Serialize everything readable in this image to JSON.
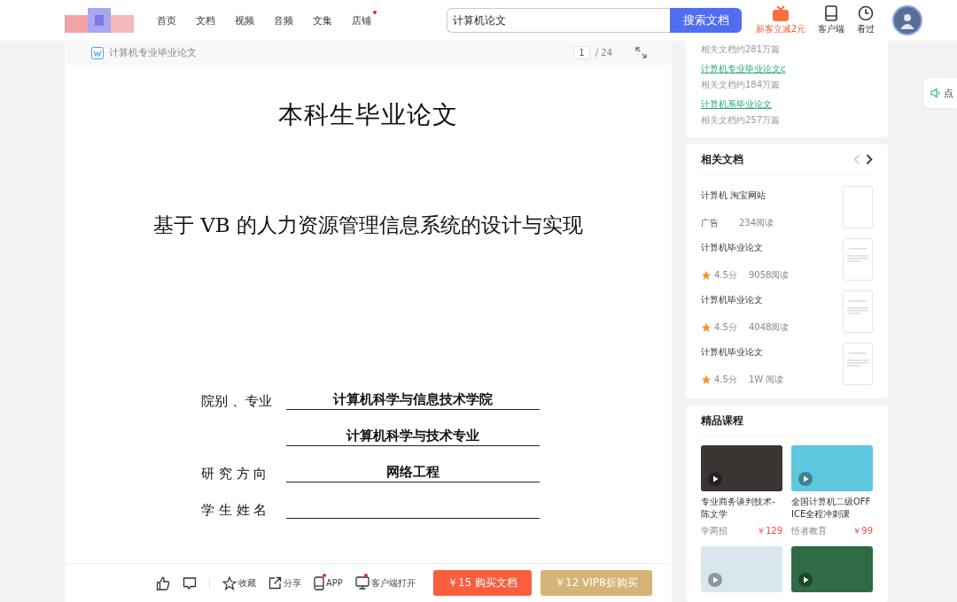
{
  "nav": [
    {
      "label": "首页",
      "dot": false
    },
    {
      "label": "文档",
      "dot": false
    },
    {
      "label": "视频",
      "dot": false
    },
    {
      "label": "音频",
      "dot": false
    },
    {
      "label": "文集",
      "dot": false
    },
    {
      "label": "店铺",
      "dot": true
    }
  ],
  "search": {
    "value": "计算机论文",
    "button": "搜索文档"
  },
  "header_actions": [
    {
      "kind": "vip",
      "label": "新客立减2元"
    },
    {
      "kind": "device",
      "label": "客户端"
    },
    {
      "kind": "clock",
      "label": "看过"
    }
  ],
  "doc_toolbar": {
    "title": "计算机专业毕业论文",
    "page": "1",
    "total": "/ 24"
  },
  "document": {
    "subtitle": "本科生毕业论文",
    "title": "基于 VB 的人力资源管理信息系统的设计与实现",
    "fields": [
      {
        "label": "院别 、专业",
        "value": "计算机科学与信息技术学院"
      },
      {
        "value": "计算机科学与技术专业"
      },
      {
        "label": "研 究 方 向",
        "value": "网络工程"
      },
      {
        "label": "学 生 姓 名"
      }
    ]
  },
  "actions": [
    {
      "kind": "like",
      "dot": false
    },
    {
      "kind": "comment",
      "dot": false
    },
    {
      "kind": "star",
      "label": "收藏",
      "dot": false
    },
    {
      "kind": "share",
      "label": "分享",
      "dot": false
    },
    {
      "kind": "phone",
      "label": "APP",
      "dot": true
    },
    {
      "kind": "monitor",
      "label": "客户端打开",
      "dot": true
    }
  ],
  "buy_buttons": [
    {
      "kind": "buy",
      "label": "￥15 购买文档"
    },
    {
      "kind": "vip",
      "label": "￥12 VIP8折购买"
    }
  ],
  "related_searches": [
    {
      "count": "相关文档约281万篇"
    },
    {
      "link": "计算机专业毕业论文c",
      "count": "相关文档约184万篇"
    },
    {
      "link": "计算机系毕业论文",
      "count": "相关文档约257万篇"
    }
  ],
  "related_docs": {
    "title": "相关文档",
    "items": [
      {
        "kind": "ad",
        "title": "计算机 淘宝网站",
        "tag": "广告",
        "reads": "234阅读"
      },
      {
        "kind": "doc",
        "title": "计算机毕业论文",
        "score": "4.5分",
        "reads": "9058阅读"
      },
      {
        "kind": "doc",
        "title": "计算机毕业论文",
        "score": "4.5分",
        "reads": "4048阅读"
      },
      {
        "kind": "doc",
        "title": "计算机毕业论文",
        "score": "4.5分",
        "reads": "1W 阅读"
      }
    ]
  },
  "courses": {
    "title": "精品课程",
    "items": [
      {
        "kind": "course",
        "title": "专业商务谈判技术-陈文学",
        "provider": "学两招",
        "price": "￥129"
      },
      {
        "kind": "course",
        "title": "全国计算机二级OFFICE全程冲刺课",
        "provider": "悟者教育",
        "price": "￥99"
      },
      {
        "kind": "thumbnail"
      },
      {
        "kind": "thumbnail"
      }
    ]
  },
  "float_button": {
    "label": "点"
  }
}
